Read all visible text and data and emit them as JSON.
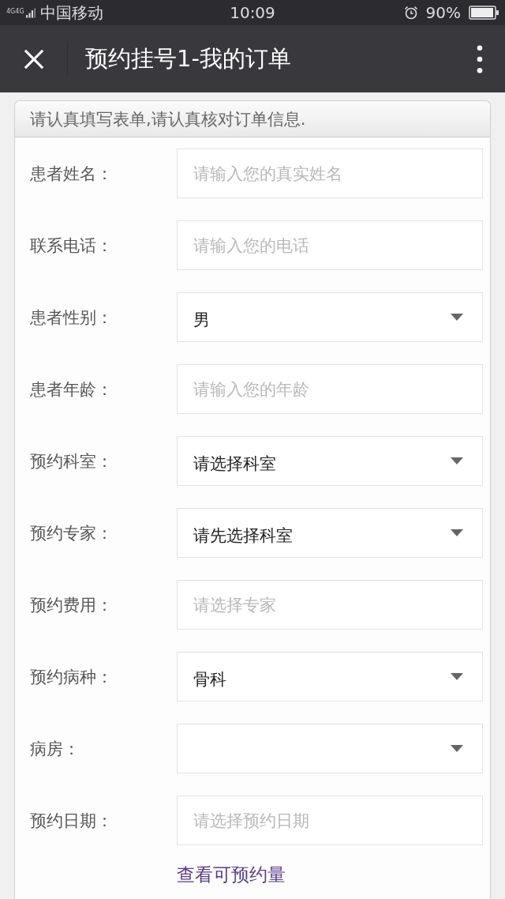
{
  "status_bar": {
    "network": "4G4G",
    "carrier": "中国移动",
    "time": "10:09",
    "battery": "90%"
  },
  "header": {
    "title": "预约挂号1-我的订单"
  },
  "form": {
    "notice": "请认真填写表单,请认真核对订单信息.",
    "fields": [
      {
        "label": "患者姓名：",
        "kind": "input",
        "placeholder": "请输入您的真实姓名"
      },
      {
        "label": "联系电话：",
        "kind": "input",
        "placeholder": "请输入您的电话"
      },
      {
        "label": "患者性别：",
        "kind": "select",
        "value": "男"
      },
      {
        "label": "患者年龄：",
        "kind": "input",
        "placeholder": "请输入您的年龄"
      },
      {
        "label": "预约科室：",
        "kind": "select",
        "value": "请选择科室"
      },
      {
        "label": "预约专家：",
        "kind": "select",
        "value": "请先选择科室"
      },
      {
        "label": "预约费用：",
        "kind": "input",
        "placeholder": "请选择专家"
      },
      {
        "label": "预约病种：",
        "kind": "select",
        "value": "骨科"
      },
      {
        "label": "病房：",
        "kind": "select"
      },
      {
        "label": "预约日期：",
        "kind": "input",
        "placeholder": "请选择预约日期"
      }
    ],
    "link": "查看可预约量"
  }
}
